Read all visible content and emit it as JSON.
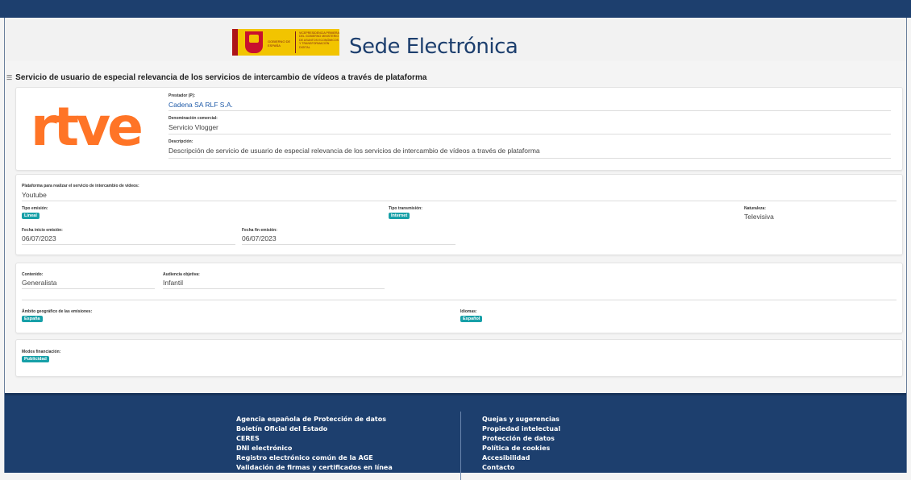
{
  "header": {
    "logo_text_main": "GOBIERNO DE ESPAÑA",
    "logo_text_ministry": "VICEPRESIDENCIA PRIMERA DEL GOBIERNO MINISTERIO DE ASUNTOS ECONÓMICOS Y TRANSFORMACIÓN DIGITAL",
    "site_title": "Sede Electrónica"
  },
  "page": {
    "heading": "Servicio de usuario de especial relevancia de los servicios de intercambio de vídeos a través de plataforma"
  },
  "provider": {
    "logo_text": "rtve",
    "prestador_label": "Prestador (P):",
    "prestador_value": "Cadena SA RLF S.A.",
    "denominacion_label": "Denominación comercial:",
    "denominacion_value": "Servicio Vlogger",
    "descripcion_label": "Descripción:",
    "descripcion_value": "Descripción de servicio de usuario de especial relevancia de los servicios de intercambio de vídeos a través de plataforma"
  },
  "emission": {
    "plataforma_label": "Plataforma para realizar el servicio de intercambio de vídeos:",
    "plataforma_value": "Youtube",
    "tipo_emision_label": "Tipo emisión:",
    "tipo_emision_value": "Lineal",
    "tipo_transmision_label": "Tipo transmisión:",
    "tipo_transmision_value": "Internet",
    "naturaleza_label": "Naturaleza:",
    "naturaleza_value": "Televisiva",
    "fecha_inicio_label": "Fecha inicio emisión:",
    "fecha_inicio_value": "06/07/2023",
    "fecha_fin_label": "Fecha fin emisión:",
    "fecha_fin_value": "06/07/2023"
  },
  "content": {
    "contenido_label": "Contenido:",
    "contenido_value": "Generalista",
    "audiencia_label": "Audiencia objetiva:",
    "audiencia_value": "Infantil",
    "ambito_label": "Ámbito geográfico de las emisiones:",
    "ambito_value": "España",
    "idiomas_label": "Idiomas:",
    "idiomas_value": "Español"
  },
  "financing": {
    "modos_label": "Modos financiación:",
    "modos_value": "Publicidad"
  },
  "footer": {
    "left_links": [
      "Agencia española de Protección de datos",
      "Boletín Oficial del Estado",
      "CERES",
      "DNI electrónico",
      "Registro electrónico común de la AGE",
      "Validación de firmas y certificados en línea"
    ],
    "right_links": [
      "Quejas y sugerencias",
      "Propiedad intelectual",
      "Protección de datos",
      "Política de cookies",
      "Accesibilidad",
      "Contacto"
    ]
  },
  "colors": {
    "brand_navy": "#1d3f6e",
    "badge_teal": "#17a0a8",
    "rtve_orange": "#ff7426",
    "link_blue": "#1e5aa8"
  }
}
